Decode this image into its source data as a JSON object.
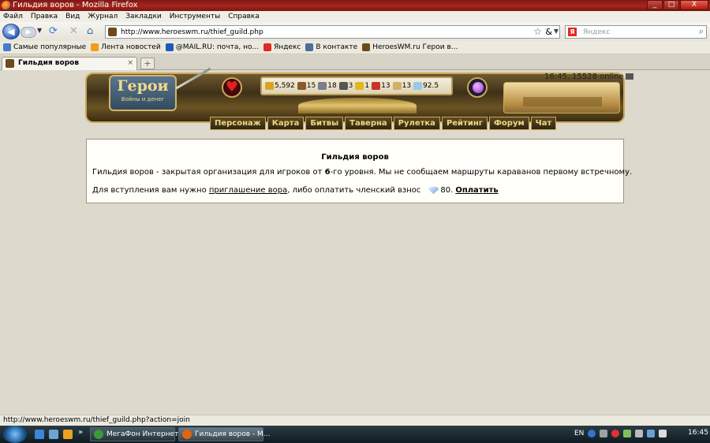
{
  "window": {
    "title": "Гильдия воров - Mozilla Firefox",
    "buttons": [
      "_",
      "□",
      "X"
    ]
  },
  "menu": [
    "Файл",
    "Правка",
    "Вид",
    "Журнал",
    "Закладки",
    "Инструменты",
    "Справка"
  ],
  "nav": {
    "url": "http://www.heroeswm.ru/thief_guild.php",
    "search_placeholder": "Яндекс",
    "search_engine_letter": "Я"
  },
  "bookmarks": [
    {
      "label": "Самые популярные",
      "color": "#4a7bc8"
    },
    {
      "label": "Лента новостей",
      "color": "#f29b1d"
    },
    {
      "label": "@MAIL.RU: почта, но...",
      "color": "#1d5bb8"
    },
    {
      "label": "Яндекс",
      "color": "#e02b20"
    },
    {
      "label": "В контакте",
      "color": "#4c6d94"
    },
    {
      "label": "HeroesWM.ru Герои в...",
      "color": "#6b4a1c"
    }
  ],
  "tab": {
    "label": "Гильдия воров",
    "close": "×",
    "new_tab": "+"
  },
  "game": {
    "logo_title": "Герои",
    "logo_subtitle": "Войны и денег",
    "clock": "16:45, 15528 online",
    "resources": [
      {
        "value": "5,592",
        "color": "#d9a520"
      },
      {
        "value": "15",
        "color": "#8a5a2b"
      },
      {
        "value": "18",
        "color": "#7a7f8a"
      },
      {
        "value": "3",
        "color": "#555555"
      },
      {
        "value": "1",
        "color": "#e0b824"
      },
      {
        "value": "13",
        "color": "#c8322a"
      },
      {
        "value": "13",
        "color": "#d2b06a"
      },
      {
        "value": "92.5",
        "color": "#9ac7ea"
      }
    ],
    "menu": [
      "Персонаж",
      "Карта",
      "Битвы",
      "Таверна",
      "Рулетка",
      "Рейтинг",
      "Форум",
      "Чат"
    ]
  },
  "guild": {
    "title": "Гильдия воров",
    "desc_pre": "Гильдия воров - закрытая организация для игроков от ",
    "desc_level": "6",
    "desc_post": "-го уровня. Мы не сообщаем маршруты караванов первому встречному.",
    "join_pre": "Для вступления вам нужно ",
    "join_link": "приглашение вора",
    "join_mid": ", либо оплатить членский взнос",
    "fee": "80.",
    "pay": "Оплатить"
  },
  "status": "http://www.heroeswm.ru/thief_guild.php?action=join",
  "taskbar": {
    "tasks": [
      "МегаФон Интернет",
      "Гильдия воров - М..."
    ],
    "lang": "EN",
    "time": "16:45",
    "chevron": "»"
  }
}
